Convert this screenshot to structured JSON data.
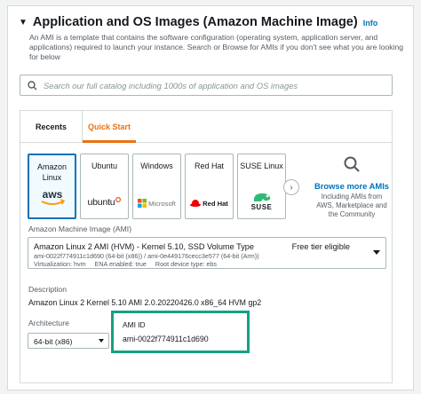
{
  "section": {
    "title": "Application and OS Images (Amazon Machine Image)",
    "info_link": "Info",
    "description": "An AMI is a template that contains the software configuration (operating system, application server, and applications) required to launch your instance. Search or Browse for AMIs if you don't see what you are looking for below"
  },
  "search": {
    "placeholder": "Search our full catalog including 1000s of application and OS images"
  },
  "tabs": [
    {
      "label": "Recents",
      "active": false
    },
    {
      "label": "Quick Start",
      "active": true
    }
  ],
  "os_tiles": [
    {
      "label_line1": "Amazon",
      "label_line2": "Linux",
      "logo_text": "aws",
      "selected": true
    },
    {
      "label_line1": "Ubuntu",
      "label_line2": "",
      "logo_text": "ubuntu",
      "selected": false
    },
    {
      "label_line1": "Windows",
      "label_line2": "",
      "logo_text": "Microsoft",
      "selected": false
    },
    {
      "label_line1": "Red Hat",
      "label_line2": "",
      "logo_text": "Red Hat",
      "selected": false
    },
    {
      "label_line1": "SUSE Linux",
      "label_line2": "",
      "logo_text": "SUSE",
      "selected": false
    }
  ],
  "browse": {
    "title": "Browse more AMIs",
    "subtitle": "Including AMIs from AWS, Marketplace and the Community"
  },
  "ami_field": {
    "label": "Amazon Machine Image (AMI)",
    "name": "Amazon Linux 2 AMI (HVM) - Kernel 5.10, SSD Volume Type",
    "badge": "Free tier eligible",
    "ids": "ami-0022f774911c1d690 (64-bit (x86)) / ami-0e449176cecc3e577 (64-bit (Arm))",
    "meta": "Virtualization: hvm     ENA enabled: true     Root device type: ebs"
  },
  "description_field": {
    "label": "Description",
    "value": "Amazon Linux 2 Kernel 5.10 AMI 2.0.20220426.0 x86_64 HVM gp2"
  },
  "architecture_field": {
    "label": "Architecture",
    "value": "64-bit (x86)"
  },
  "ami_id_field": {
    "label": "AMI ID",
    "value": "ami-0022f774911c1d690"
  },
  "colors": {
    "accent_orange": "#ec7211",
    "link_blue": "#0073bb",
    "highlight_teal": "#16a085",
    "redhat_red": "#ee0000",
    "suse_green": "#30ba78",
    "ubuntu_orange": "#e95420"
  }
}
